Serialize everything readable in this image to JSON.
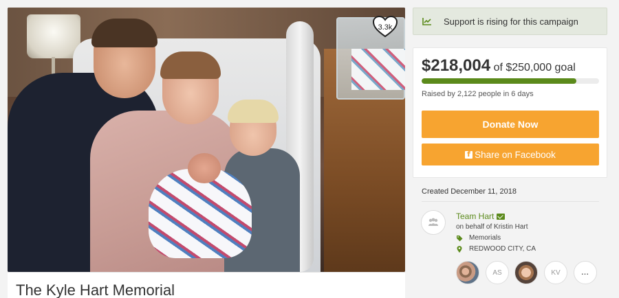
{
  "campaign": {
    "title": "The Kyle Hart Memorial",
    "likes": "3.3k"
  },
  "trend": {
    "text": "Support is rising for this campaign",
    "icon": "chart-trending-up-icon"
  },
  "donation": {
    "raised": "$218,004",
    "goal": "of $250,000 goal",
    "progress_percent": 87.2,
    "raised_by": "Raised by 2,122 people in 6 days",
    "donate_label": "Donate Now",
    "share_label": "Share on Facebook",
    "accent_color": "#f7a430",
    "progress_color": "#5b8a1b"
  },
  "details": {
    "created": "Created December 11, 2018",
    "organizer_name": "Team Hart",
    "on_behalf": "on behalf of Kristin Hart",
    "category": "Memorials",
    "location": "REDWOOD CITY, CA"
  },
  "donors": {
    "initials_1": "AS",
    "initials_2": "KV",
    "more_label": "..."
  }
}
